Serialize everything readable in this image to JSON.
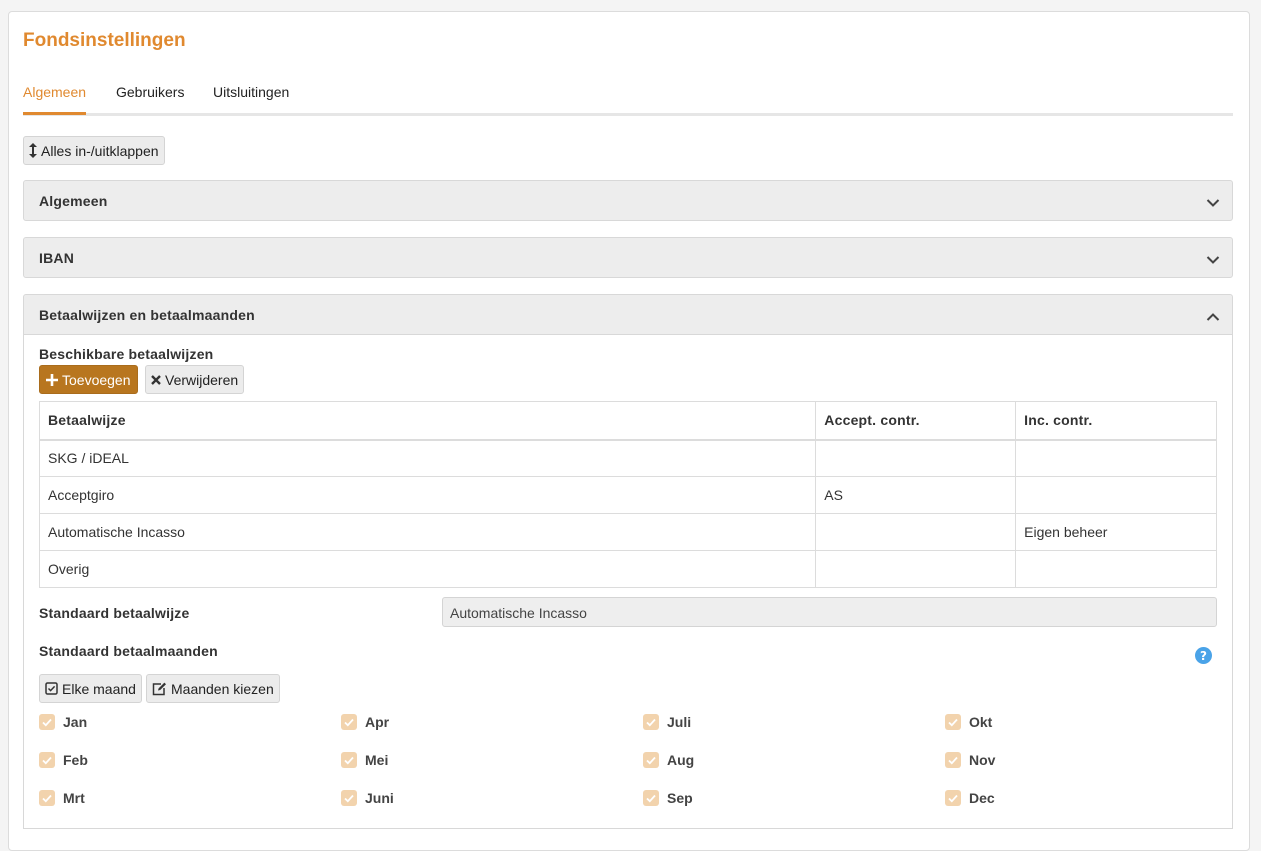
{
  "page": {
    "title": "Fondsinstellingen"
  },
  "tabs": [
    {
      "label": "Algemeen",
      "active": true
    },
    {
      "label": "Gebruikers",
      "active": false
    },
    {
      "label": "Uitsluitingen",
      "active": false
    }
  ],
  "toolbar": {
    "toggle_all_label": "Alles in-/uitklappen",
    "toggle_icon": "vertical-arrows-icon"
  },
  "panels": [
    {
      "title": "Algemeen",
      "expanded": false
    },
    {
      "title": "IBAN",
      "expanded": false
    },
    {
      "title": "Betaalwijzen en betaalmaanden",
      "expanded": true
    }
  ],
  "payment": {
    "available_label": "Beschikbare betaalwijzen",
    "add_label": "Toevoegen",
    "remove_label": "Verwijderen",
    "columns": [
      "Betaalwijze",
      "Accept. contr.",
      "Inc. contr."
    ],
    "rows": [
      [
        "SKG / iDEAL",
        "",
        ""
      ],
      [
        "Acceptgiro",
        "AS",
        ""
      ],
      [
        "Automatische Incasso",
        "",
        "Eigen beheer"
      ],
      [
        "Overig",
        "",
        ""
      ]
    ],
    "default_method_label": "Standaard betaalwijze",
    "default_method_value": "Automatische Incasso",
    "default_months_label": "Standaard betaalmaanden",
    "every_month_label": "Elke maand",
    "choose_months_label": "Maanden kiezen",
    "months": [
      "Jan",
      "Feb",
      "Mrt",
      "Apr",
      "Mei",
      "Juni",
      "Juli",
      "Aug",
      "Sep",
      "Okt",
      "Nov",
      "Dec"
    ]
  },
  "colors": {
    "accent": "#e0892f",
    "primary_button": "#b8761f",
    "checkbox_disabled": "#f2d3ad",
    "help_icon": "#4aa3e8"
  }
}
